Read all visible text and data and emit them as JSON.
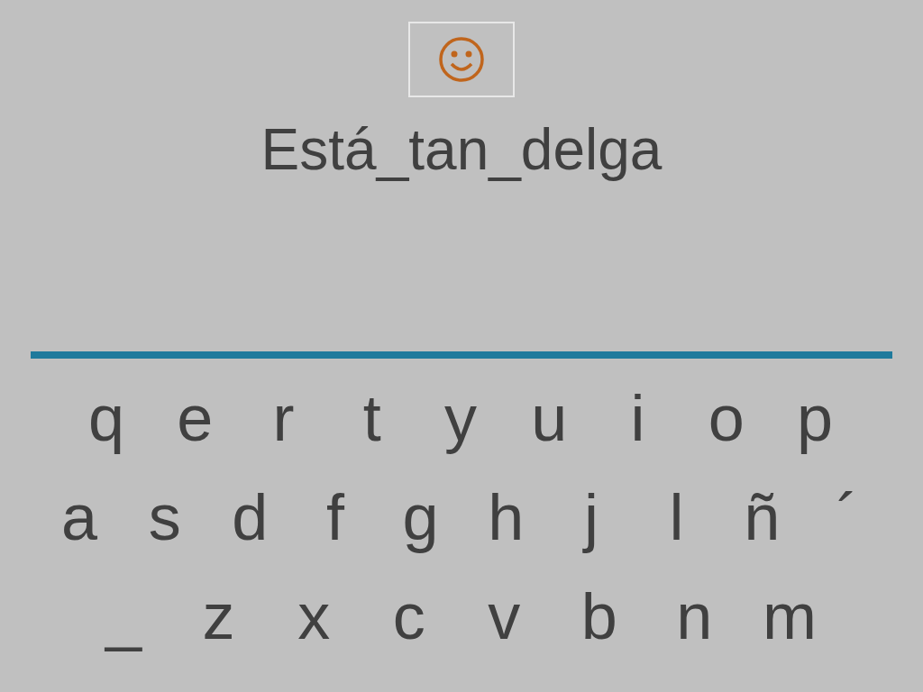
{
  "word": {
    "text": "Está_tan_delga"
  },
  "keyboard": {
    "rows": [
      [
        "q",
        "e",
        "r",
        "t",
        "y",
        "u",
        "i",
        "o",
        "p"
      ],
      [
        "a",
        "s",
        "d",
        "f",
        "g",
        "h",
        "j",
        "l",
        "ñ",
        "´"
      ],
      [
        "_",
        "z",
        "x",
        "c",
        "v",
        "b",
        "n",
        "m"
      ]
    ]
  }
}
